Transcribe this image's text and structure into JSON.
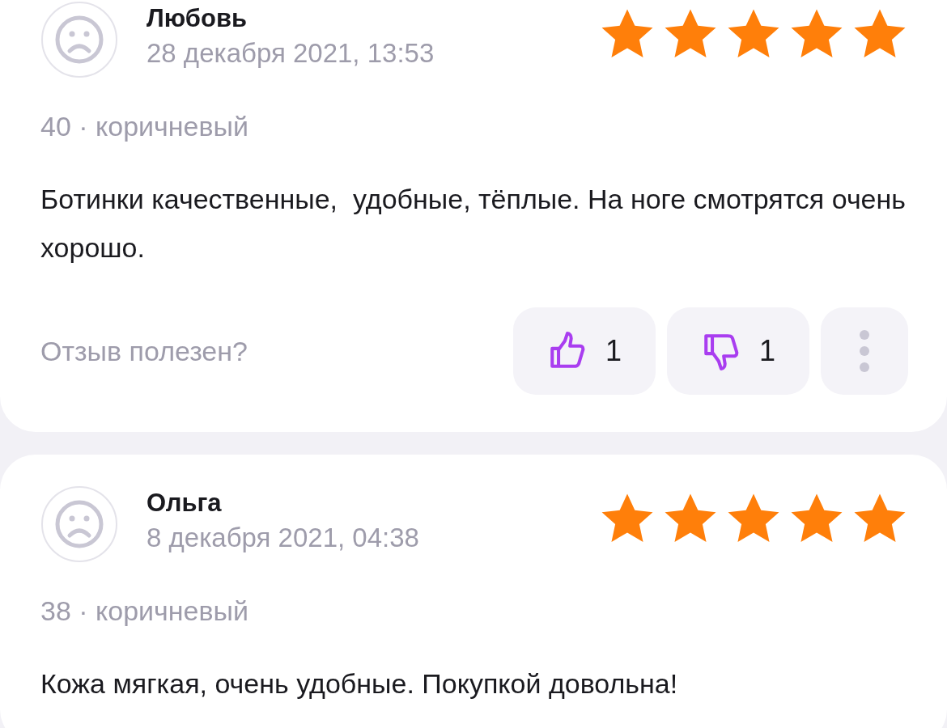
{
  "reviews": [
    {
      "author": "Любовь",
      "date": "28 декабря 2021, 13:53",
      "stars": 5,
      "variant": "40 · коричневый",
      "text": "Ботинки качественные,  удобные, тёплые. На ноге смотрятся очень хорошо.",
      "helpful_prompt": "Отзыв полезен?",
      "likes": "1",
      "dislikes": "1"
    },
    {
      "author": "Ольга",
      "date": "8 декабря 2021, 04:38",
      "stars": 5,
      "variant": "38 · коричневый",
      "text": "Кожа мягкая, очень удобные. Покупкой довольна!"
    }
  ]
}
